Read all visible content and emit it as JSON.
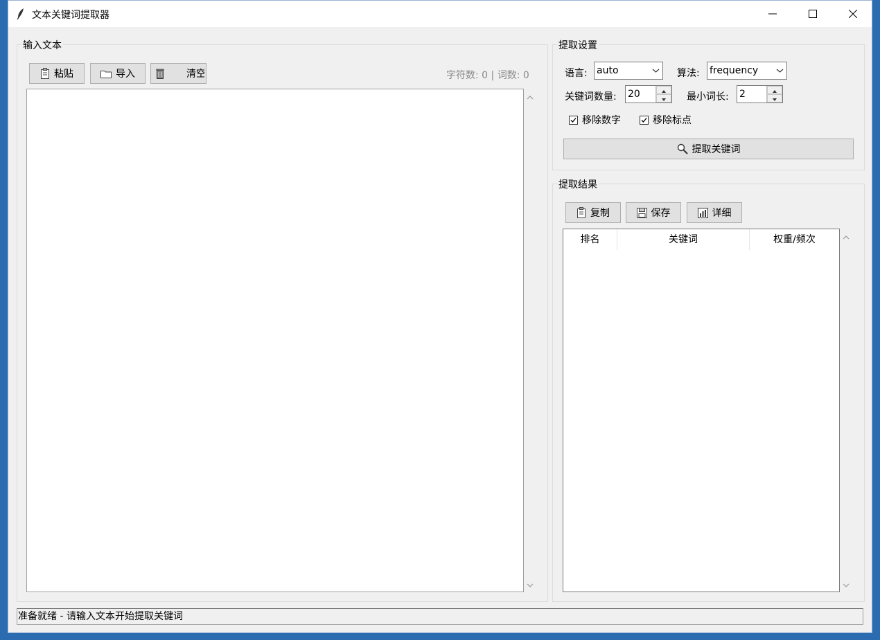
{
  "window": {
    "title": "文本关键词提取器"
  },
  "input_panel": {
    "title": "输入文本",
    "buttons": {
      "paste": "粘贴",
      "import": "导入",
      "clear": "清空"
    },
    "stats": "字符数: 0 | 词数: 0",
    "text_value": ""
  },
  "settings_panel": {
    "title": "提取设置",
    "language_label": "语言:",
    "language_value": "auto",
    "algorithm_label": "算法:",
    "algorithm_value": "frequency",
    "keyword_count_label": "关键词数量:",
    "keyword_count_value": "20",
    "min_length_label": "最小词长:",
    "min_length_value": "2",
    "remove_numbers_label": "移除数字",
    "remove_numbers_checked": true,
    "remove_punct_label": "移除标点",
    "remove_punct_checked": true,
    "extract_button": "提取关键词"
  },
  "results_panel": {
    "title": "提取结果",
    "buttons": {
      "copy": "复制",
      "save": "保存",
      "detail": "详细"
    },
    "columns": [
      "排名",
      "关键词",
      "权重/频次"
    ],
    "rows": []
  },
  "statusbar": {
    "text": "准备就绪 - 请输入文本开始提取关键词"
  }
}
